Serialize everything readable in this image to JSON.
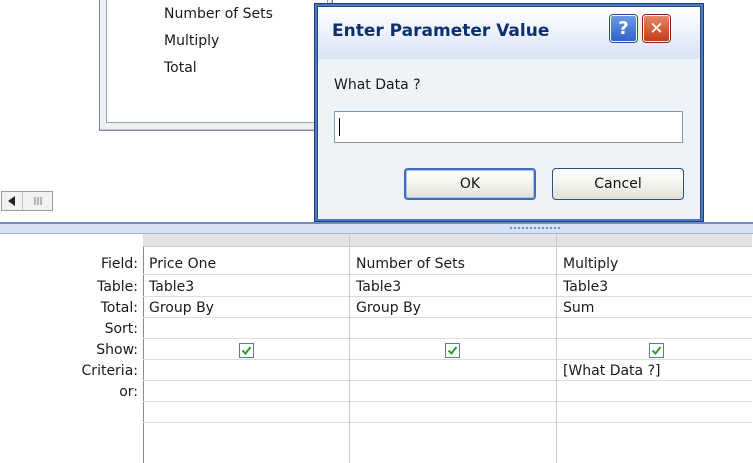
{
  "table_box": {
    "fields": [
      "Number of Sets",
      "Multiply",
      "Total"
    ]
  },
  "dialog": {
    "title": "Enter Parameter Value",
    "help_glyph": "?",
    "close_glyph": "✕",
    "prompt": "What Data ?",
    "input_value": "",
    "ok_label": "OK",
    "cancel_label": "Cancel"
  },
  "grid": {
    "row_labels": [
      "Field:",
      "Table:",
      "Total:",
      "Sort:",
      "Show:",
      "Criteria:",
      "or:"
    ],
    "columns": [
      {
        "field": "Price One",
        "table": "Table3",
        "total": "Group By",
        "sort": "",
        "show": true,
        "criteria": "",
        "or": ""
      },
      {
        "field": "Number of Sets",
        "table": "Table3",
        "total": "Group By",
        "sort": "",
        "show": true,
        "criteria": "",
        "or": ""
      },
      {
        "field": "Multiply",
        "table": "Table3",
        "total": "Sum",
        "sort": "",
        "show": true,
        "criteria": "[What Data ?]",
        "or": ""
      }
    ]
  },
  "icons": {
    "scroll_left": "triangle-left-icon",
    "scroll_thumb": "grip-icon",
    "check": "checkmark-icon"
  },
  "colors": {
    "title_text": "#0b2f73",
    "checkmark": "#2f9a2f",
    "close_button": "#c33a16",
    "help_button": "#2e63c9"
  }
}
